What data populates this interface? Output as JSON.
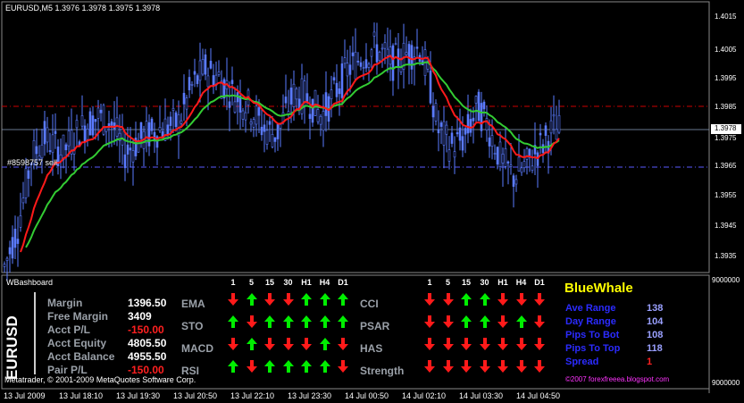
{
  "chart": {
    "header": "EURUSD,M5  1.3976 1.3978 1.3975 1.3978",
    "order_label": "#8598757 sell",
    "copyright": "Metatrader, © 2001-2009 MetaQuotes Software Corp.",
    "price_labels": [
      "1.4015",
      "1.4005",
      "1.3995",
      "1.3985",
      "1.3978",
      "1.3975",
      "1.3965",
      "1.3955",
      "1.3945",
      "1.3935"
    ],
    "current_price": "1.3978",
    "time_labels": [
      "13 Jul 2009",
      "13 Jul 18:10",
      "13 Jul 19:30",
      "13 Jul 20:50",
      "13 Jul 22:10",
      "13 Jul 23:30",
      "14 Jul 00:50",
      "14 Jul 02:10",
      "14 Jul 03:30",
      "14 Jul 04:50"
    ],
    "colors": {
      "ma_fast": "#ff1a1a",
      "ma_slow": "#33cc33",
      "level_red": "#cc0000",
      "level_blue": "#5a5aff",
      "candles": "#4a66ff"
    }
  },
  "panel": {
    "title": "WBashboard",
    "scale_top": "9000000",
    "scale_bottom": "9000000",
    "symbol": "EURUSD",
    "account": [
      {
        "label": "Margin",
        "value": "1396.50",
        "color": "#ffffff"
      },
      {
        "label": "Free Margin",
        "value": "3409",
        "color": "#ffffff"
      },
      {
        "label": "Acct P/L",
        "value": "-150.00",
        "color": "#ff2020"
      },
      {
        "label": "Acct Equity",
        "value": "4805.50",
        "color": "#ffffff"
      },
      {
        "label": "Acct Balance",
        "value": "4955.50",
        "color": "#ffffff"
      },
      {
        "label": "Pair P/L",
        "value": "-150.00",
        "color": "#ff2020"
      }
    ],
    "timeframes": [
      "1",
      "5",
      "15",
      "30",
      "H1",
      "H4",
      "D1"
    ],
    "left_indicators": [
      {
        "name": "EMA",
        "signals": [
          "down",
          "up",
          "down",
          "down",
          "up",
          "up",
          "up"
        ]
      },
      {
        "name": "STO",
        "signals": [
          "up",
          "down",
          "up",
          "up",
          "up",
          "up",
          "up"
        ]
      },
      {
        "name": "MACD",
        "signals": [
          "down",
          "up",
          "down",
          "down",
          "down",
          "up",
          "down"
        ]
      },
      {
        "name": "RSI",
        "signals": [
          "up",
          "down",
          "up",
          "up",
          "up",
          "up",
          "down"
        ]
      }
    ],
    "right_indicators": [
      {
        "name": "CCI",
        "signals": [
          "down",
          "down",
          "up",
          "up",
          "down",
          "down",
          "down"
        ]
      },
      {
        "name": "PSAR",
        "signals": [
          "down",
          "down",
          "up",
          "up",
          "down",
          "up",
          "down"
        ]
      },
      {
        "name": "HAS",
        "signals": [
          "down",
          "down",
          "down",
          "down",
          "down",
          "down",
          "down"
        ]
      },
      {
        "name": "Strength",
        "signals": [
          "down",
          "down",
          "down",
          "down",
          "down",
          "down",
          "down"
        ]
      }
    ],
    "bluewhale": {
      "title": "BlueWhale",
      "rows": [
        {
          "label": "Ave Range",
          "value": "138"
        },
        {
          "label": "Day Range",
          "value": "104"
        },
        {
          "label": "Pips To Bot",
          "value": "108"
        },
        {
          "label": "Pips To Top",
          "value": "118"
        },
        {
          "label": "Spread",
          "value": "1",
          "value_color": "#ff2020"
        }
      ],
      "footer": "©2007 forexfreeea.blogspot.com"
    }
  }
}
